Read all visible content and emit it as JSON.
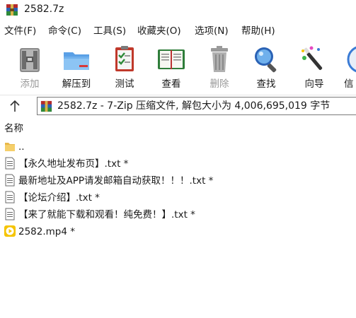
{
  "window": {
    "title": "2582.7z"
  },
  "menu": [
    "文件(F)",
    "命令(C)",
    "工具(S)",
    "收藏夹(O)",
    "选项(N)",
    "帮助(H)"
  ],
  "toolbar": {
    "add": "添加",
    "extract": "解压到",
    "test": "测试",
    "view": "查看",
    "delete": "删除",
    "find": "查找",
    "wizard": "向导",
    "info": "信"
  },
  "path": {
    "text": "2582.7z - 7-Zip 压缩文件, 解包大小为 4,006,695,019 字节"
  },
  "columns": {
    "name": "名称"
  },
  "files": [
    {
      "name": "..",
      "icon": "folder-up-icon"
    },
    {
      "name": "【永久地址发布页】.txt *",
      "icon": "text-file-icon"
    },
    {
      "name": "最新地址及APP请发邮箱自动获取！！！.txt *",
      "icon": "text-file-icon"
    },
    {
      "name": "【论坛介绍】.txt *",
      "icon": "text-file-icon"
    },
    {
      "name": "【来了就能下载和观看！纯免费！】.txt *",
      "icon": "text-file-icon"
    },
    {
      "name": "2582.mp4 *",
      "icon": "video-file-icon"
    }
  ],
  "colors": {
    "accent": "#3a7bd5",
    "disabled_text": "#9a9a9a",
    "video_icon": "#f5c400"
  }
}
